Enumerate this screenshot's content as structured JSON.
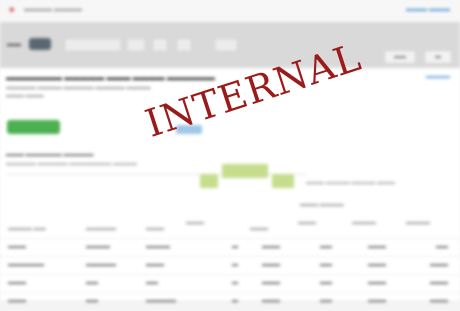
{
  "watermark": {
    "text": "INTERNAL"
  }
}
